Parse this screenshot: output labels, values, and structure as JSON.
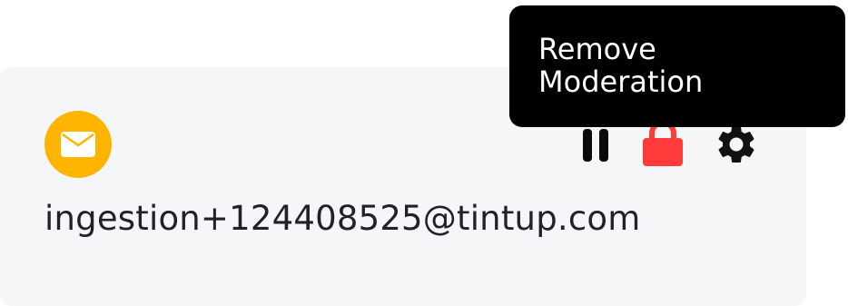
{
  "source": {
    "icon": "envelope-icon",
    "color": "#ffb400",
    "email": "ingestion+124408525@tintup.com"
  },
  "actions": {
    "pause_icon": "pause-icon",
    "lock_icon": "lock-icon",
    "lock_color": "#ff3b3b",
    "settings_icon": "gear-icon"
  },
  "tooltip": {
    "line1": "Remove",
    "line2": "Moderation"
  }
}
